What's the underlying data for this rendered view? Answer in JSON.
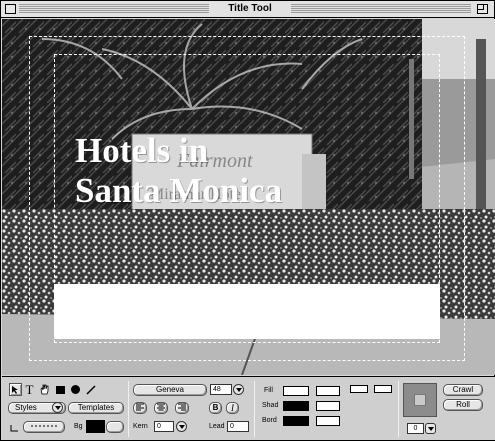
{
  "window": {
    "title": "Title Tool"
  },
  "canvas": {
    "title_lines": [
      "Hotels in",
      "Santa Monica"
    ],
    "sign_text": [
      "Fairmont",
      "Miramar Hotel"
    ]
  },
  "toolbar": {
    "tools": [
      "selection-tool",
      "text-tool",
      "hand-tool",
      "rectangle-tool",
      "oval-tool",
      "line-tool"
    ],
    "styles_label": "Styles",
    "templates_label": "Templates",
    "font_name": "Geneva",
    "font_size": "48",
    "bg_label": "Bg",
    "kern_label": "Kern",
    "kern_value": "0",
    "lead_label": "Lead",
    "lead_value": "0",
    "fill_label": "Fill",
    "shad_label": "Shad",
    "bord_label": "Bord",
    "crawl_label": "Crawl",
    "roll_label": "Roll",
    "opacity_value": "0"
  },
  "colors": {
    "fill": "#ffffff",
    "shadow": "#000000",
    "border": "#000000",
    "background_swatch": "#000000"
  }
}
